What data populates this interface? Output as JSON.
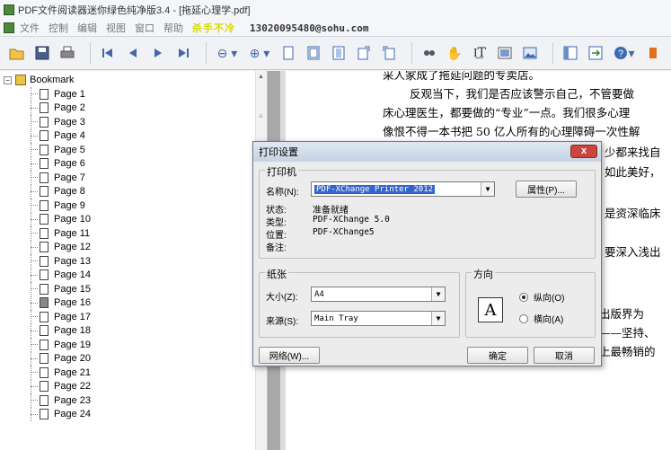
{
  "window": {
    "title": "PDF文件阅读器迷你绿色纯净版3.4 - [拖延心理学.pdf]"
  },
  "menubar": {
    "items": [
      "文件",
      "控制",
      "编辑",
      "视图",
      "窗口",
      "帮助"
    ],
    "tagline": "杀手不冷",
    "email": "13020095480@sohu.com"
  },
  "toolbar": {
    "icons": [
      "open-icon",
      "save-icon",
      "print-icon",
      "first-page-icon",
      "prev-page-icon",
      "next-page-icon",
      "last-page-icon",
      "zoom-out-icon",
      "zoom-in-icon",
      "single-page-icon",
      "continuous-icon",
      "facing-icon",
      "rotate-icon",
      "rotate-cw-icon",
      "search-icon",
      "hand-icon",
      "text-select-icon",
      "snapshot-icon",
      "image-icon",
      "sidebar-toggle-icon",
      "fullscreen-icon",
      "help-icon"
    ]
  },
  "sidebar": {
    "root_label": "Bookmark",
    "items": [
      "Page 1",
      "Page 2",
      "Page 3",
      "Page 4",
      "Page 5",
      "Page 6",
      "Page 7",
      "Page 8",
      "Page 9",
      "Page 10",
      "Page 11",
      "Page 12",
      "Page 13",
      "Page 14",
      "Page 15",
      "Page 16",
      "Page 17",
      "Page 18",
      "Page 19",
      "Page 20",
      "Page 21",
      "Page 22",
      "Page 23",
      "Page 24"
    ],
    "active_index": 15
  },
  "document": {
    "lines": [
      "采人家成了拖延问题的专卖店。",
      "反观当下，我们是否应该警示自己，不管要做",
      "床心理医生，都要做的“专业”一点。我们很多心理",
      "像恨不得一本书把 50 亿人所有的心理障碍一次性解",
      "少都来找自",
      "如此美好，",
      "是资深临床",
      "要深入浅出",
      "出版界为",
      "——坚持、",
      "上最畅销的"
    ]
  },
  "dialog": {
    "title": "打印设置",
    "close_label": "x",
    "printer_group": "打印机",
    "name_label": "名称(N):",
    "name_value": "PDF-XChange Printer 2012",
    "properties_button": "属性(P)...",
    "status_label": "状态:",
    "status_value": "准备就绪",
    "type_label": "类型:",
    "type_value": "PDF-XChange 5.0",
    "location_label": "位置:",
    "location_value": "PDF-XChange5",
    "comment_label": "备注:",
    "paper_group": "纸张",
    "size_label": "大小(Z):",
    "size_value": "A4",
    "source_label": "来源(S):",
    "source_value": "Main Tray",
    "orientation_group": "方向",
    "orientation_icon_text": "A",
    "portrait_label": "纵向(O)",
    "landscape_label": "横向(A)",
    "network_button": "网络(W)...",
    "ok_button": "确定",
    "cancel_button": "取消"
  }
}
